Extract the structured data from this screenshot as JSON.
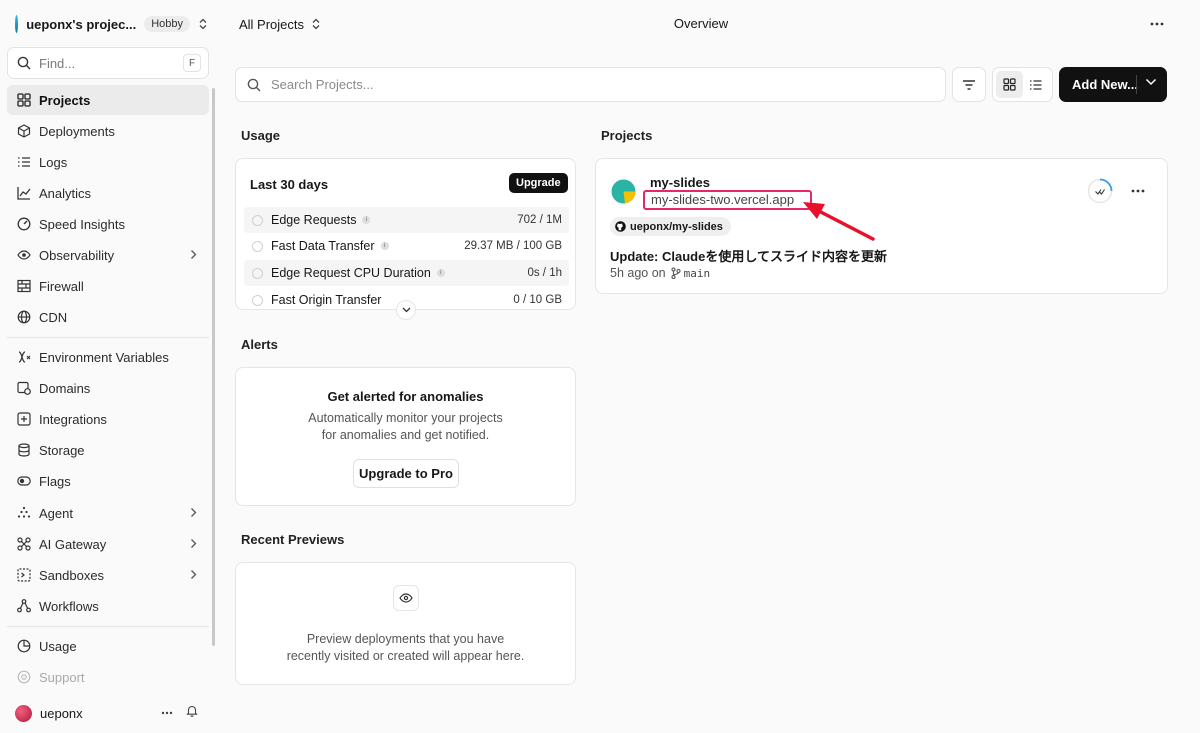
{
  "team": {
    "name": "ueponx's projec...",
    "plan": "Hobby"
  },
  "find": {
    "placeholder": "Find...",
    "shortcut": "F"
  },
  "nav": [
    {
      "label": "Projects",
      "icon": "grid-icon",
      "active": true
    },
    {
      "label": "Deployments",
      "icon": "cube-icon"
    },
    {
      "label": "Logs",
      "icon": "list-icon"
    },
    {
      "label": "Analytics",
      "icon": "chart-icon"
    },
    {
      "label": "Speed Insights",
      "icon": "gauge-icon"
    },
    {
      "label": "Observability",
      "icon": "eye-icon",
      "expandable": true
    },
    {
      "label": "Firewall",
      "icon": "firewall-icon"
    },
    {
      "label": "CDN",
      "icon": "globe-icon"
    },
    {
      "label": "Environment Variables",
      "icon": "variable-icon"
    },
    {
      "label": "Domains",
      "icon": "domain-icon"
    },
    {
      "label": "Integrations",
      "icon": "integrations-icon"
    },
    {
      "label": "Storage",
      "icon": "database-icon"
    },
    {
      "label": "Flags",
      "icon": "toggle-icon"
    },
    {
      "label": "Agent",
      "icon": "agent-icon",
      "expandable": true
    },
    {
      "label": "AI Gateway",
      "icon": "gateway-icon",
      "expandable": true
    },
    {
      "label": "Sandboxes",
      "icon": "sandbox-icon",
      "expandable": true
    },
    {
      "label": "Workflows",
      "icon": "workflow-icon"
    },
    {
      "label": "Usage",
      "icon": "usage-icon"
    },
    {
      "label": "Support",
      "icon": "support-icon",
      "muted": true
    }
  ],
  "user": {
    "name": "ueponx"
  },
  "header": {
    "scope": "All Projects",
    "title": "Overview"
  },
  "search": {
    "placeholder": "Search Projects..."
  },
  "toolbar": {
    "add_new_label": "Add New..."
  },
  "usage": {
    "section_title": "Usage",
    "period": "Last 30 days",
    "upgrade_label": "Upgrade",
    "rows": [
      {
        "label": "Edge Requests",
        "value": "702 / 1M"
      },
      {
        "label": "Fast Data Transfer",
        "value": "29.37 MB / 100 GB"
      },
      {
        "label": "Edge Request CPU Duration",
        "value": "0s / 1h"
      },
      {
        "label": "Fast Origin Transfer",
        "value": "0 / 10 GB"
      }
    ]
  },
  "alerts": {
    "section_title": "Alerts",
    "title": "Get alerted for anomalies",
    "desc_line1": "Automatically monitor your projects",
    "desc_line2": "for anomalies and get notified.",
    "button_label": "Upgrade to Pro"
  },
  "previews": {
    "section_title": "Recent Previews",
    "desc_line1": "Preview deployments that you have",
    "desc_line2": "recently visited or created will appear here."
  },
  "projects": {
    "section_title": "Projects",
    "items": [
      {
        "name": "my-slides",
        "url": "my-slides-two.vercel.app",
        "repo": "ueponx/my-slides",
        "commit_message": "Update: Claudeを使用してスライド内容を更新",
        "time": "5h ago on",
        "branch": "main"
      }
    ]
  },
  "colors": {
    "highlight": "#e8266b",
    "arrow": "#e8102a",
    "primary": "#111111"
  }
}
